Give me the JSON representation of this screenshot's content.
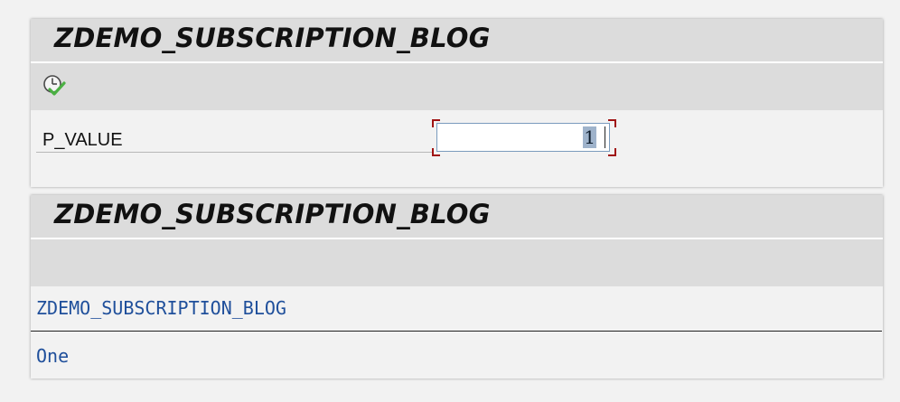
{
  "selection_screen": {
    "title": "ZDEMO_SUBSCRIPTION_BLOG",
    "toolbar": {
      "execute_icon": "execute-icon"
    },
    "parameter": {
      "label": "P_VALUE",
      "value": "1"
    }
  },
  "list_output": {
    "title": "ZDEMO_SUBSCRIPTION_BLOG",
    "header": "ZDEMO_SUBSCRIPTION_BLOG",
    "lines": [
      "One"
    ]
  },
  "colors": {
    "title_bar": "#dcdcdc",
    "list_text": "#1f4f9b",
    "focus_corners": "#a01313",
    "selection_highlight": "#9fb3cb"
  }
}
